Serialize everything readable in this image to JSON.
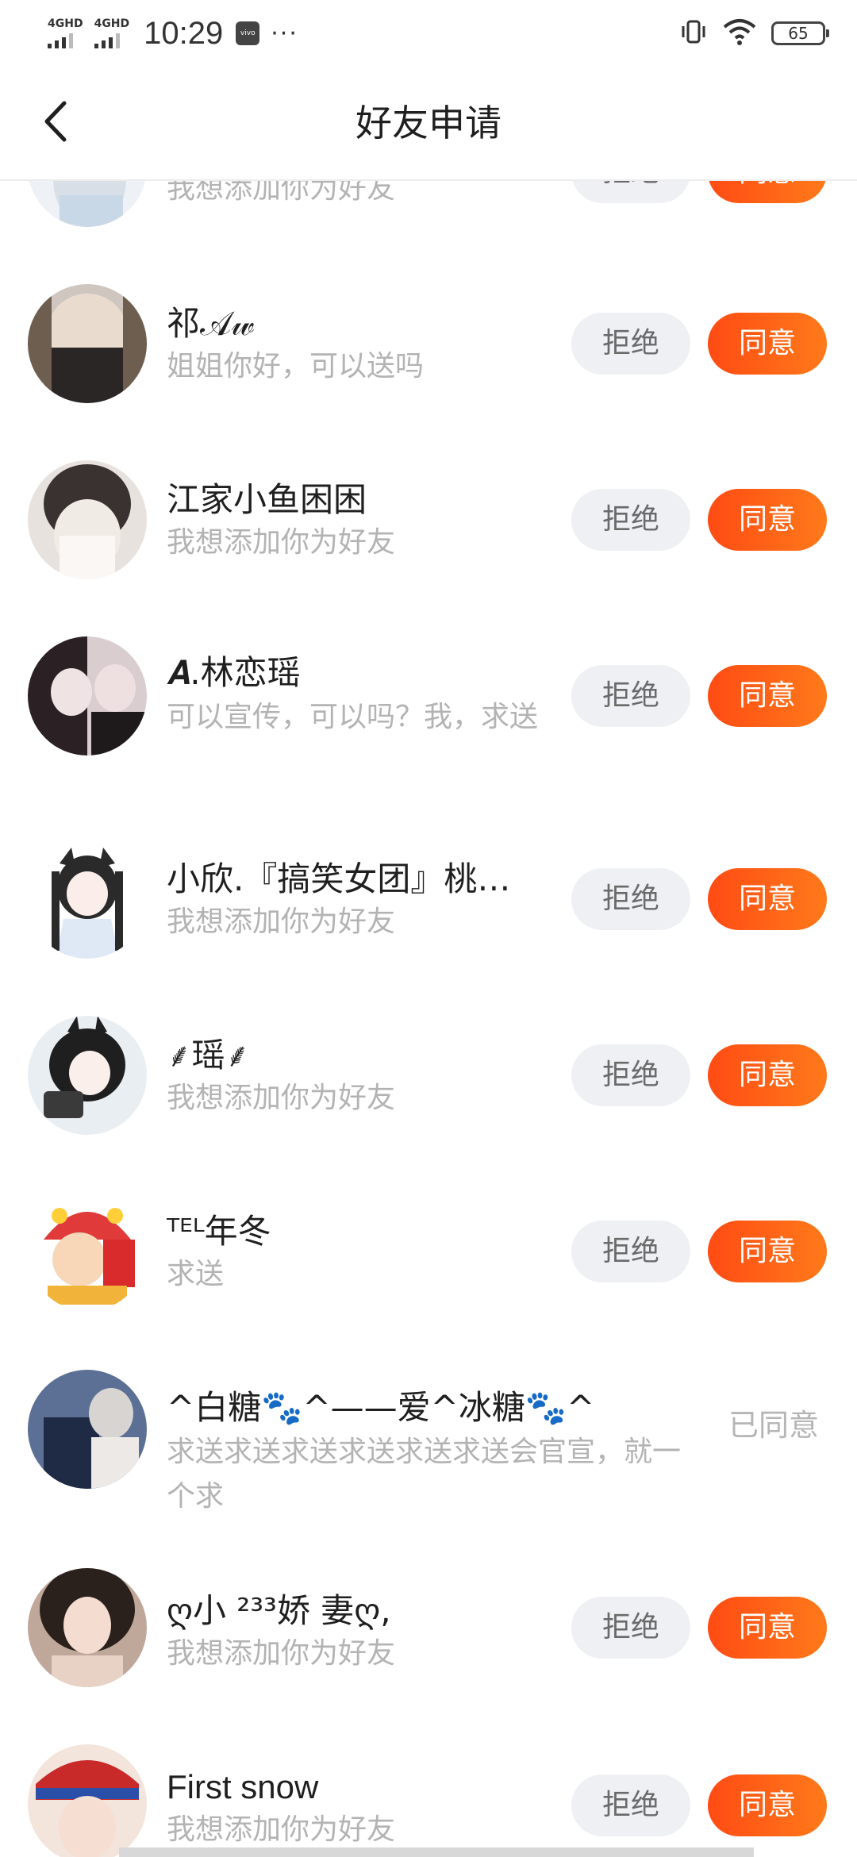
{
  "status_bar": {
    "signal1": "4GHD",
    "signal2": "4GHD",
    "time": "10:29",
    "vivo": "vivo",
    "more": "···",
    "battery": "65"
  },
  "header": {
    "title": "好友申请",
    "back_icon": "chevron-left-icon"
  },
  "actions": {
    "reject": "拒绝",
    "accept": "同意",
    "accepted": "已同意"
  },
  "colors": {
    "accent": "#ff5a17",
    "reject_bg": "#eef0f4",
    "secondary_text": "#b3b3b3"
  },
  "requests": [
    {
      "name": "",
      "message": "我想添加你为好友",
      "status": "pending"
    },
    {
      "name": "祁𝒜𝓌",
      "message": "姐姐你好，可以送吗",
      "status": "pending"
    },
    {
      "name": "江家小鱼困困",
      "message": "我想添加你为好友",
      "status": "pending"
    },
    {
      "name": "𝑨.林恋瑶",
      "message": "可以宣传，可以吗？我，求送",
      "status": "pending"
    },
    {
      "name": "小欣.『搞笑女团』桃…",
      "message": "我想添加你为好友",
      "status": "pending"
    },
    {
      "name": "⸙瑶⸙",
      "message": "我想添加你为好友",
      "status": "pending"
    },
    {
      "name": "ᵀᴱᴸ年冬",
      "message": "求送",
      "status": "pending"
    },
    {
      "name": "^白糖🐾^——爱^冰糖🐾^",
      "message": "求送求送求送求送求送求送会官宣，就一个求",
      "status": "accepted"
    },
    {
      "name": "ღ小 ²³³娇 妻ღ,",
      "message": "我想添加你为好友",
      "status": "pending"
    },
    {
      "name": "First snow",
      "message": "我想添加你为好友",
      "status": "pending"
    }
  ]
}
